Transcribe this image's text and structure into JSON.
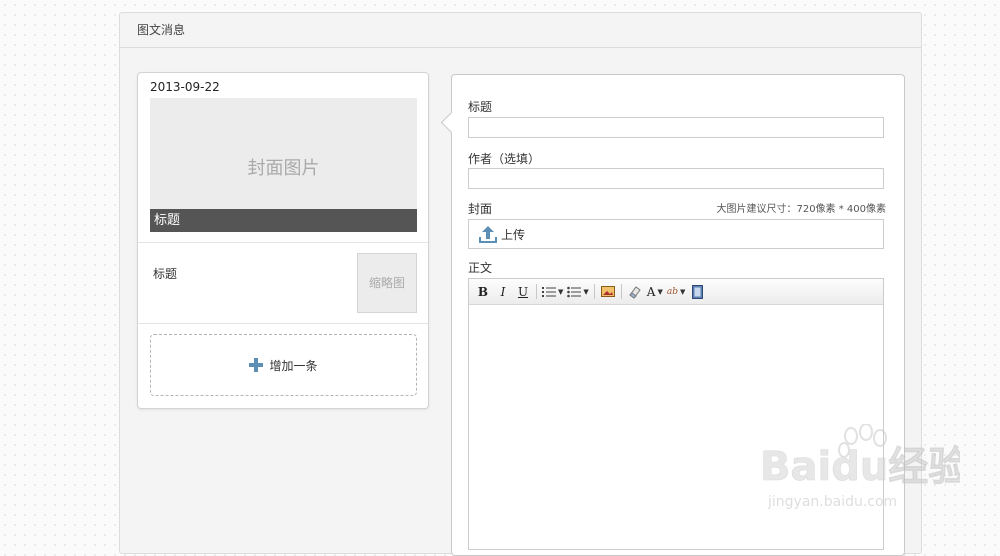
{
  "header": {
    "title": "图文消息"
  },
  "list": {
    "date": "2013-09-22",
    "cover_placeholder": "封面图片",
    "cover_title": "标题",
    "item_title": "标题",
    "thumb_placeholder": "缩略图",
    "add_label": "增加一条"
  },
  "editor": {
    "title_label": "标题",
    "title_value": "",
    "author_label": "作者（选填）",
    "author_value": "",
    "cover_label": "封面",
    "cover_hint": "大图片建议尺寸：720像素 * 400像素",
    "upload_label": "上传",
    "body_label": "正文",
    "toolbar": {
      "bold": "B",
      "italic": "I",
      "underline": "U",
      "font_color": "A",
      "highlight": "ab"
    }
  },
  "watermark": {
    "brand": "Baidu经验",
    "url": "jingyan.baidu.com"
  },
  "colors": {
    "accent_blue": "#5c8fb5",
    "cover_title_bg": "#555555"
  }
}
